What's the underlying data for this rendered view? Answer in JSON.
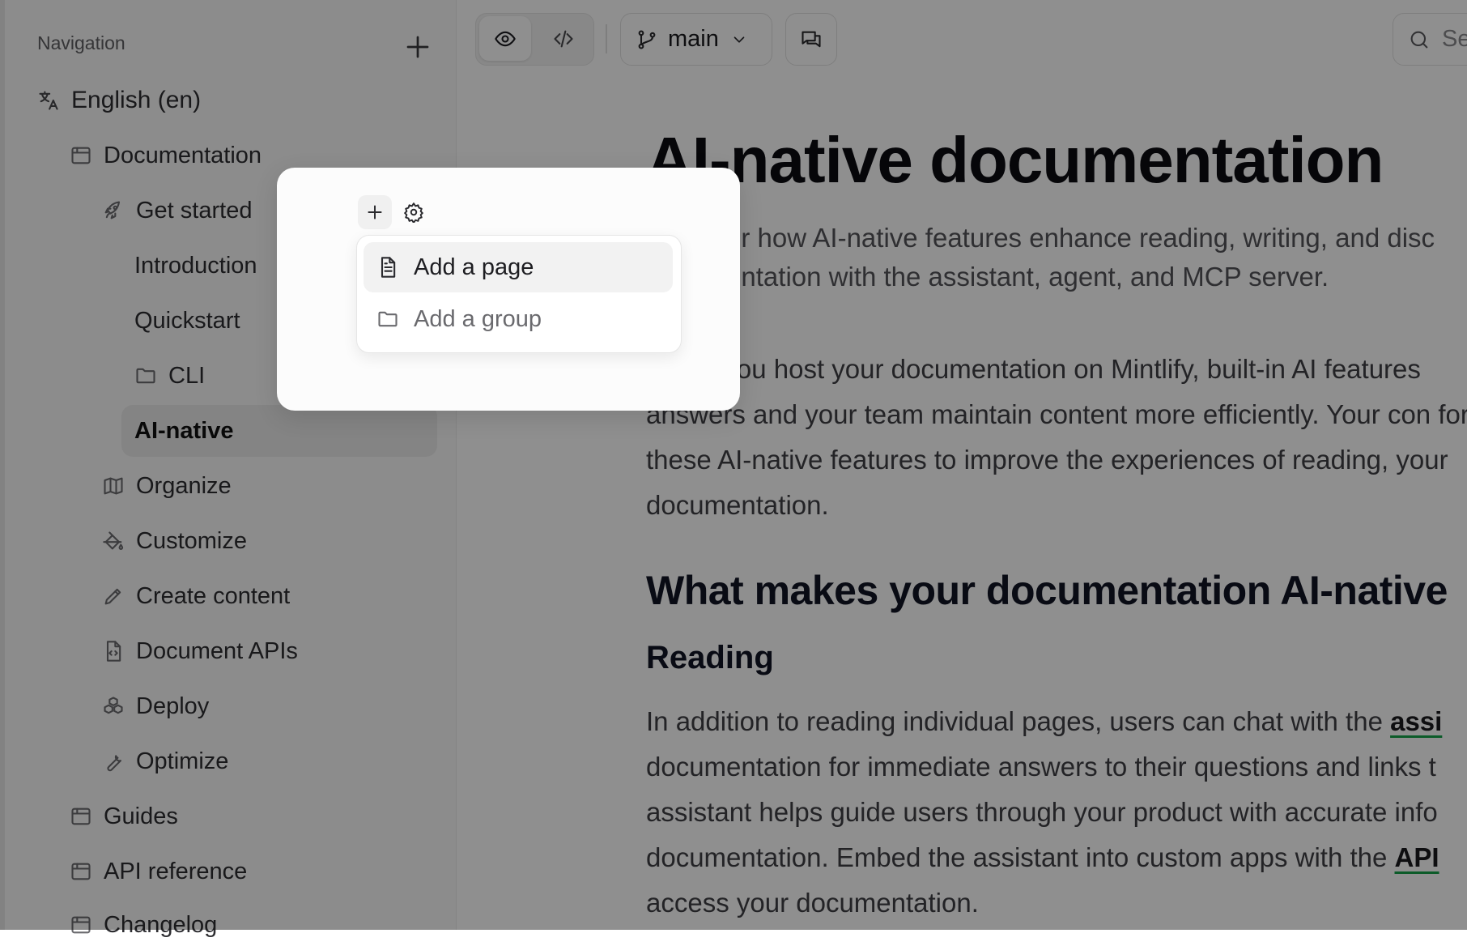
{
  "sidebar": {
    "title": "Navigation",
    "language": "English (en)",
    "items": [
      {
        "label": "Documentation",
        "icon": "book-tab-icon"
      },
      {
        "label": "Get started",
        "icon": "rocket-icon"
      },
      {
        "label": "Introduction"
      },
      {
        "label": "Quickstart"
      },
      {
        "label": "CLI",
        "icon": "folder-icon"
      },
      {
        "label": "AI-native",
        "active": true
      },
      {
        "label": "Organize",
        "icon": "map-icon"
      },
      {
        "label": "Customize",
        "icon": "paint-bucket-icon"
      },
      {
        "label": "Create content",
        "icon": "pencil-icon"
      },
      {
        "label": "Document APIs",
        "icon": "file-code-icon"
      },
      {
        "label": "Deploy",
        "icon": "boxes-icon"
      },
      {
        "label": "Optimize",
        "icon": "wrench-icon"
      },
      {
        "label": "Guides",
        "icon": "book-tab-icon"
      },
      {
        "label": "API reference",
        "icon": "book-tab-icon"
      },
      {
        "label": "Changelog",
        "icon": "book-tab-icon"
      }
    ]
  },
  "toolbar": {
    "branch": "main",
    "search_placeholder": "Se"
  },
  "content": {
    "title": "AI-native documentation",
    "lead": "Discover how AI-native features enhance reading, writing, and disc documentation with the assistant, agent, and MCP server.",
    "para1": "When you host your documentation on Mintlify, built-in AI features answers and your team maintain content more efficiently. Your con for these AI-native features to improve the experiences of reading, your documentation.",
    "h2": "What makes your documentation AI-native",
    "h3": "Reading",
    "para2_a": "In addition to reading individual pages, users can chat with the ",
    "para2_link": "assi",
    "para2_b": " documentation for immediate answers to their questions and links t assistant helps guide users through your product with accurate info documentation. Embed the assistant into custom apps with the ",
    "para2_link2": "API",
    "para2_c": " access your documentation."
  },
  "popover": {
    "menu": [
      "Add a page",
      "Add a group"
    ]
  },
  "colors": {
    "overlay": "#000000",
    "accent_underline": "#16a34a"
  }
}
